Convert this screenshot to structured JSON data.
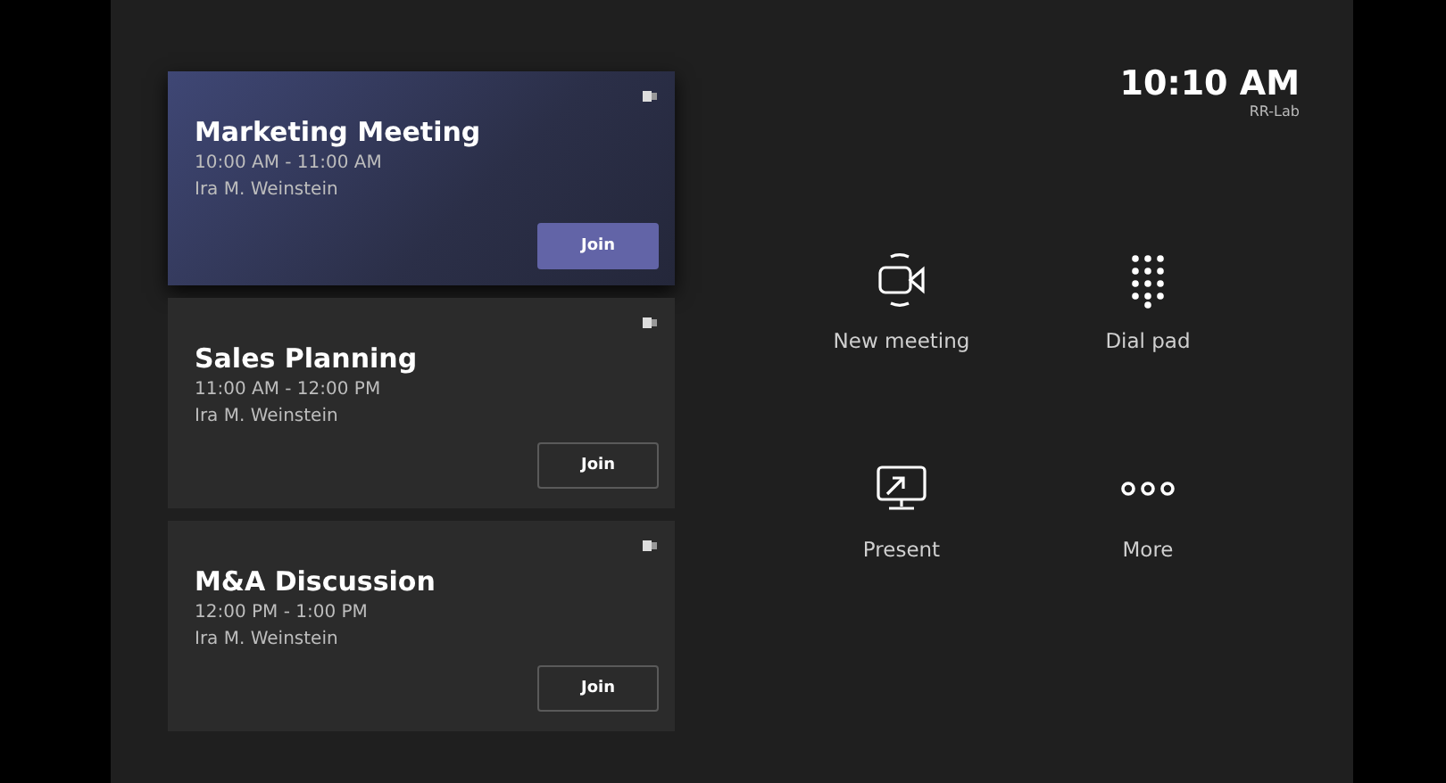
{
  "meetings": [
    {
      "title": "Marketing Meeting",
      "time": "10:00 AM - 11:00 AM",
      "organizer": "Ira M. Weinstein",
      "join": "Join",
      "selected": true
    },
    {
      "title": "Sales Planning",
      "time": "11:00 AM - 12:00 PM",
      "organizer": "Ira M. Weinstein",
      "join": "Join",
      "selected": false
    },
    {
      "title": "M&A Discussion",
      "time": "12:00 PM - 1:00 PM",
      "organizer": "Ira M. Weinstein",
      "join": "Join",
      "selected": false
    }
  ],
  "clock": {
    "time": "10:10 AM",
    "room": "RR-Lab"
  },
  "actions": [
    {
      "kind": "video",
      "label": "New meeting"
    },
    {
      "kind": "dialpad",
      "label": "Dial pad"
    },
    {
      "kind": "present",
      "label": "Present"
    },
    {
      "kind": "more",
      "label": "More"
    }
  ]
}
